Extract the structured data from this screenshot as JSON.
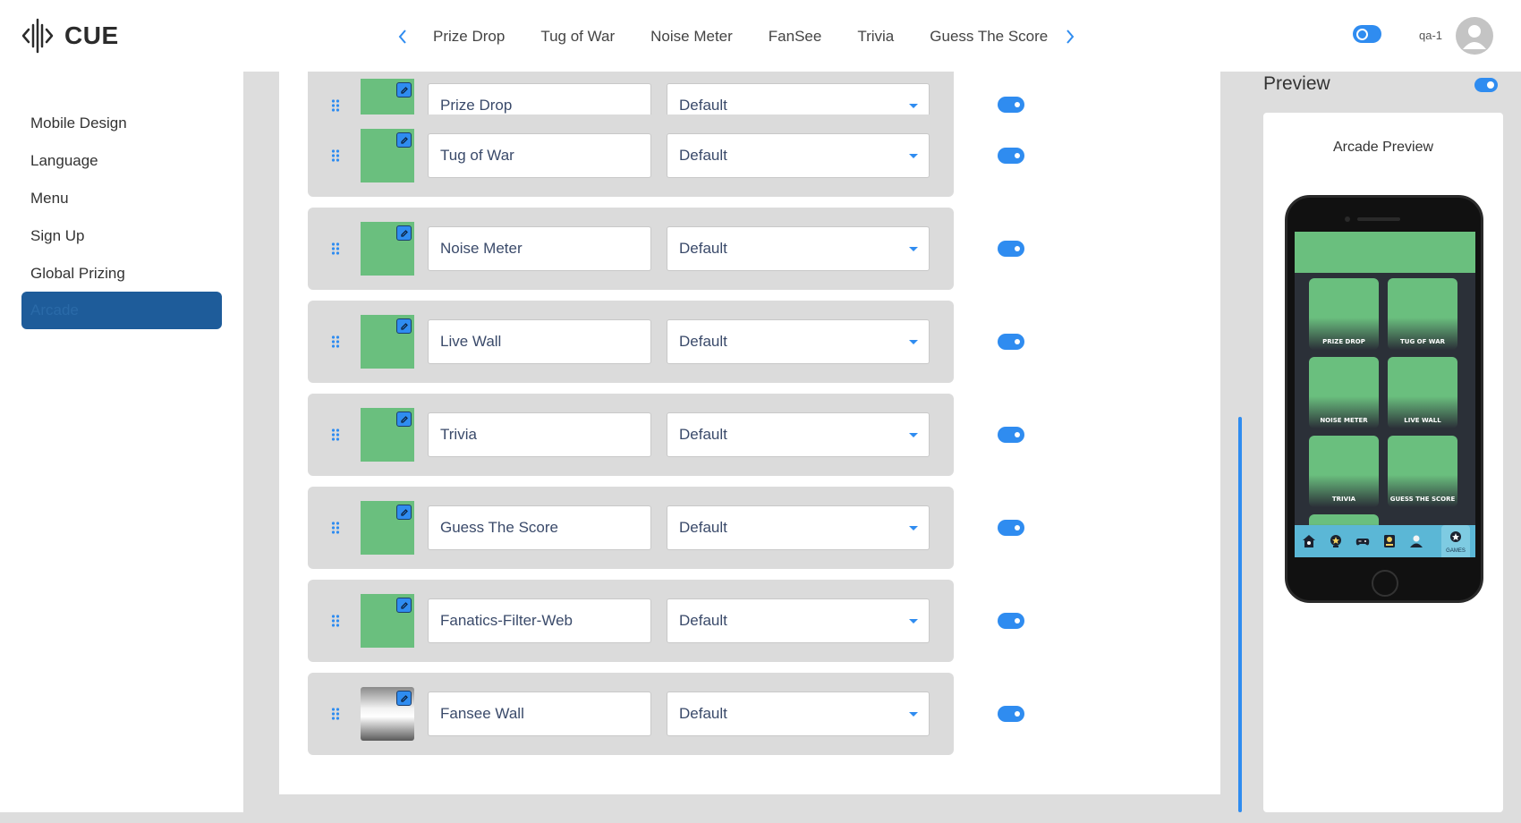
{
  "header": {
    "logo_text": "CUE",
    "nav_tabs": [
      "Prize Drop",
      "Tug of War",
      "Noise Meter",
      "FanSee",
      "Trivia",
      "Guess The Score"
    ],
    "user_name": "qa-1"
  },
  "sidebar": {
    "items": [
      {
        "label": "Mobile Design"
      },
      {
        "label": "Language"
      },
      {
        "label": "Menu"
      },
      {
        "label": "Sign Up"
      },
      {
        "label": "Global Prizing"
      },
      {
        "label": "Arcade",
        "active": true
      }
    ]
  },
  "arcade": {
    "rows": [
      {
        "name": "Prize Drop",
        "style": "Default",
        "enabled": true,
        "thumb": "green"
      },
      {
        "name": "Tug of War",
        "style": "Default",
        "enabled": true,
        "thumb": "green"
      },
      {
        "name": "Noise Meter",
        "style": "Default",
        "enabled": true,
        "thumb": "green"
      },
      {
        "name": "Live Wall",
        "style": "Default",
        "enabled": true,
        "thumb": "green"
      },
      {
        "name": "Trivia",
        "style": "Default",
        "enabled": true,
        "thumb": "green"
      },
      {
        "name": "Guess The Score",
        "style": "Default",
        "enabled": true,
        "thumb": "green"
      },
      {
        "name": "Fanatics-Filter-Web",
        "style": "Default",
        "enabled": true,
        "thumb": "green"
      },
      {
        "name": "Fansee Wall",
        "style": "Default",
        "enabled": true,
        "thumb": "silver"
      }
    ]
  },
  "preview": {
    "title": "Preview",
    "enabled": true,
    "heading": "Arcade Preview",
    "tiles": [
      "PRIZE DROP",
      "TUG OF WAR",
      "NOISE METER",
      "LIVE WALL",
      "TRIVIA",
      "GUESS THE SCORE"
    ],
    "tab_bar": {
      "active_label": "GAMES"
    }
  },
  "colors": {
    "accent": "#2f8cf0",
    "active_nav": "#1e5c9a",
    "thumb_green": "#6abf7e",
    "tab_bar": "#5bb7d6"
  }
}
